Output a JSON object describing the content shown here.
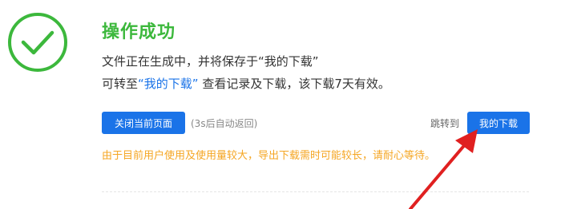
{
  "title": "操作成功",
  "message": {
    "line1": "文件正在生成中，并将保存于“我的下载”",
    "line2_prefix": "可转至",
    "line2_link": "“我的下载”",
    "line2_suffix": " 查看记录及下载，该下载7天有效。"
  },
  "actions": {
    "close_label": "关闭当前页面",
    "countdown_text": "(3s后自动返回)",
    "jump_label": "跳转到",
    "my_download_label": "我的下载"
  },
  "warning": "由于目前用户使用及使用量较大，导出下载需时可能较长，请耐心等待。",
  "icons": {
    "status": "check-circle-icon",
    "annotation": "red-arrow"
  },
  "colors": {
    "success_green": "#3cb83c",
    "primary_blue": "#1a73e8",
    "warning_orange": "#f5a623",
    "annotation_red": "#e02020"
  }
}
